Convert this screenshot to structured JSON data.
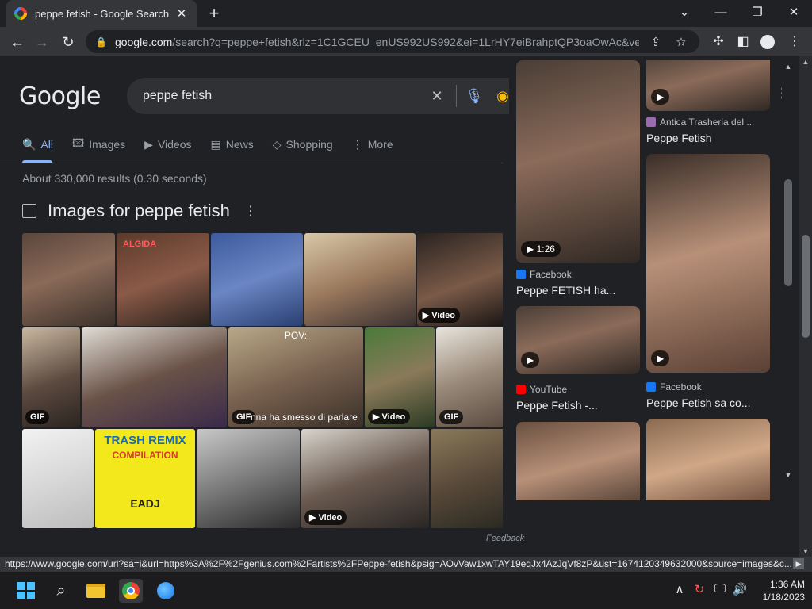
{
  "browser": {
    "tab_title": "peppe fetish - Google Search",
    "tab_close": "✕",
    "new_tab": "+",
    "window_controls": [
      "⌄",
      "—",
      "❐",
      "✕"
    ],
    "url_domain": "google.com",
    "url_path": "/search?q=peppe+fetish&rlz=1C1GCEU_enUS992US992&ei=1LrHY7eiBrahptQP3oaOwAc&ved...",
    "status_url": "https://www.google.com/url?sa=i&url=https%3A%2F%2Fgenius.com%2Fartists%2FPeppe-fetish&psig=AOvVaw1xwTAY19eqJx4AzJqVf8zP&ust=1674120349632000&source=images&c..."
  },
  "google": {
    "logo": "Google",
    "query": "peppe fetish",
    "tabs": [
      {
        "label": "All",
        "icon": "🔍"
      },
      {
        "label": "Images",
        "icon": "🖾"
      },
      {
        "label": "Videos",
        "icon": "▶"
      },
      {
        "label": "News",
        "icon": "▤"
      },
      {
        "label": "Shopping",
        "icon": "◇"
      },
      {
        "label": "More",
        "icon": "⋮"
      }
    ],
    "result_stats": "About 330,000 results (0.30 seconds)",
    "images_section_title": "Images for peppe fetish",
    "badges": {
      "video": "▶ Video",
      "gif": "GIF",
      "algida": "ALGIDA",
      "pov": "POV:",
      "subtitle": "nna ha smesso di parlare",
      "trash_remix": "TRASH REMIX",
      "compilation": "COMPILATION",
      "eadj": "EADJ"
    },
    "feedback": "Feedback"
  },
  "panel": {
    "items": [
      {
        "duration": "▶ 1:26",
        "source": "Facebook",
        "title": "Peppe FETISH ha..."
      },
      {
        "source": "Antica Trasheria del ...",
        "title": "Peppe Fetish"
      },
      {
        "source": "YouTube",
        "title": "Peppe Fetish -..."
      },
      {
        "source": "Facebook",
        "title": "Peppe Fetish sa co..."
      }
    ]
  },
  "taskbar": {
    "time": "1:36 AM",
    "date": "1/18/2023"
  },
  "colors": {
    "accent": "#8ab4f8",
    "background": "#202124",
    "facebook": "#1877f2",
    "youtube": "#ff0000"
  }
}
